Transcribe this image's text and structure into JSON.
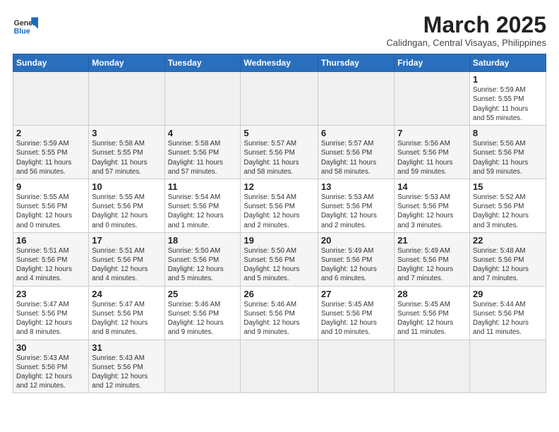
{
  "header": {
    "logo_general": "General",
    "logo_blue": "Blue",
    "month_year": "March 2025",
    "location": "Calidngan, Central Visayas, Philippines"
  },
  "days_of_week": [
    "Sunday",
    "Monday",
    "Tuesday",
    "Wednesday",
    "Thursday",
    "Friday",
    "Saturday"
  ],
  "weeks": [
    [
      {
        "day": "",
        "info": ""
      },
      {
        "day": "",
        "info": ""
      },
      {
        "day": "",
        "info": ""
      },
      {
        "day": "",
        "info": ""
      },
      {
        "day": "",
        "info": ""
      },
      {
        "day": "",
        "info": ""
      },
      {
        "day": "1",
        "info": "Sunrise: 5:59 AM\nSunset: 5:55 PM\nDaylight: 11 hours\nand 55 minutes."
      }
    ],
    [
      {
        "day": "2",
        "info": "Sunrise: 5:59 AM\nSunset: 5:55 PM\nDaylight: 11 hours\nand 56 minutes."
      },
      {
        "day": "3",
        "info": "Sunrise: 5:58 AM\nSunset: 5:55 PM\nDaylight: 11 hours\nand 57 minutes."
      },
      {
        "day": "4",
        "info": "Sunrise: 5:58 AM\nSunset: 5:56 PM\nDaylight: 11 hours\nand 57 minutes."
      },
      {
        "day": "5",
        "info": "Sunrise: 5:57 AM\nSunset: 5:56 PM\nDaylight: 11 hours\nand 58 minutes."
      },
      {
        "day": "6",
        "info": "Sunrise: 5:57 AM\nSunset: 5:56 PM\nDaylight: 11 hours\nand 58 minutes."
      },
      {
        "day": "7",
        "info": "Sunrise: 5:56 AM\nSunset: 5:56 PM\nDaylight: 11 hours\nand 59 minutes."
      },
      {
        "day": "8",
        "info": "Sunrise: 5:56 AM\nSunset: 5:56 PM\nDaylight: 11 hours\nand 59 minutes."
      }
    ],
    [
      {
        "day": "9",
        "info": "Sunrise: 5:55 AM\nSunset: 5:56 PM\nDaylight: 12 hours\nand 0 minutes."
      },
      {
        "day": "10",
        "info": "Sunrise: 5:55 AM\nSunset: 5:56 PM\nDaylight: 12 hours\nand 0 minutes."
      },
      {
        "day": "11",
        "info": "Sunrise: 5:54 AM\nSunset: 5:56 PM\nDaylight: 12 hours\nand 1 minute."
      },
      {
        "day": "12",
        "info": "Sunrise: 5:54 AM\nSunset: 5:56 PM\nDaylight: 12 hours\nand 2 minutes."
      },
      {
        "day": "13",
        "info": "Sunrise: 5:53 AM\nSunset: 5:56 PM\nDaylight: 12 hours\nand 2 minutes."
      },
      {
        "day": "14",
        "info": "Sunrise: 5:53 AM\nSunset: 5:56 PM\nDaylight: 12 hours\nand 3 minutes."
      },
      {
        "day": "15",
        "info": "Sunrise: 5:52 AM\nSunset: 5:56 PM\nDaylight: 12 hours\nand 3 minutes."
      }
    ],
    [
      {
        "day": "16",
        "info": "Sunrise: 5:51 AM\nSunset: 5:56 PM\nDaylight: 12 hours\nand 4 minutes."
      },
      {
        "day": "17",
        "info": "Sunrise: 5:51 AM\nSunset: 5:56 PM\nDaylight: 12 hours\nand 4 minutes."
      },
      {
        "day": "18",
        "info": "Sunrise: 5:50 AM\nSunset: 5:56 PM\nDaylight: 12 hours\nand 5 minutes."
      },
      {
        "day": "19",
        "info": "Sunrise: 5:50 AM\nSunset: 5:56 PM\nDaylight: 12 hours\nand 5 minutes."
      },
      {
        "day": "20",
        "info": "Sunrise: 5:49 AM\nSunset: 5:56 PM\nDaylight: 12 hours\nand 6 minutes."
      },
      {
        "day": "21",
        "info": "Sunrise: 5:49 AM\nSunset: 5:56 PM\nDaylight: 12 hours\nand 7 minutes."
      },
      {
        "day": "22",
        "info": "Sunrise: 5:48 AM\nSunset: 5:56 PM\nDaylight: 12 hours\nand 7 minutes."
      }
    ],
    [
      {
        "day": "23",
        "info": "Sunrise: 5:47 AM\nSunset: 5:56 PM\nDaylight: 12 hours\nand 8 minutes."
      },
      {
        "day": "24",
        "info": "Sunrise: 5:47 AM\nSunset: 5:56 PM\nDaylight: 12 hours\nand 8 minutes."
      },
      {
        "day": "25",
        "info": "Sunrise: 5:46 AM\nSunset: 5:56 PM\nDaylight: 12 hours\nand 9 minutes."
      },
      {
        "day": "26",
        "info": "Sunrise: 5:46 AM\nSunset: 5:56 PM\nDaylight: 12 hours\nand 9 minutes."
      },
      {
        "day": "27",
        "info": "Sunrise: 5:45 AM\nSunset: 5:56 PM\nDaylight: 12 hours\nand 10 minutes."
      },
      {
        "day": "28",
        "info": "Sunrise: 5:45 AM\nSunset: 5:56 PM\nDaylight: 12 hours\nand 11 minutes."
      },
      {
        "day": "29",
        "info": "Sunrise: 5:44 AM\nSunset: 5:56 PM\nDaylight: 12 hours\nand 11 minutes."
      }
    ],
    [
      {
        "day": "30",
        "info": "Sunrise: 5:43 AM\nSunset: 5:56 PM\nDaylight: 12 hours\nand 12 minutes."
      },
      {
        "day": "31",
        "info": "Sunrise: 5:43 AM\nSunset: 5:56 PM\nDaylight: 12 hours\nand 12 minutes."
      },
      {
        "day": "",
        "info": ""
      },
      {
        "day": "",
        "info": ""
      },
      {
        "day": "",
        "info": ""
      },
      {
        "day": "",
        "info": ""
      },
      {
        "day": "",
        "info": ""
      }
    ]
  ]
}
